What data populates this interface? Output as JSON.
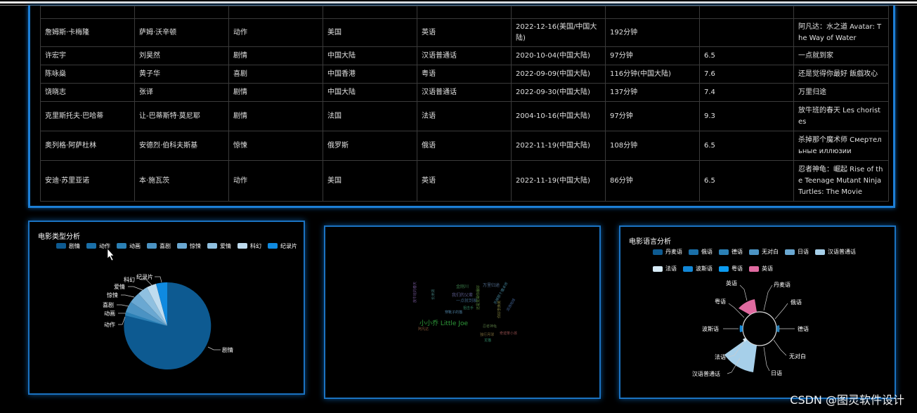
{
  "table": {
    "rows": [
      [
        "",
        "",
        "",
        "",
        "",
        "",
        "",
        "",
        "",
        "|"
      ],
      [
        "詹姆斯·卡梅隆",
        "萨姆·沃辛顿",
        "动作",
        "美国",
        "英语",
        "2022-12-16(美国/中国大陆)",
        "192分钟",
        "",
        "阿凡达：水之道 Avatar: The Way of Water"
      ],
      [
        "许宏宇",
        "刘昊然",
        "剧情",
        "中国大陆",
        "汉语普通话",
        "2020-10-04(中国大陆)",
        "97分钟",
        "6.5",
        "一点就到家"
      ],
      [
        "陈咏燊",
        "黄子华",
        "喜剧",
        "中国香港",
        "粤语",
        "2022-09-09(中国大陆)",
        "116分钟(中国大陆)",
        "7.6",
        "还是觉得你最好 飯戲攻心"
      ],
      [
        "饶晓志",
        "张译",
        "剧情",
        "中国大陆",
        "汉语普通话",
        "2022-09-30(中国大陆)",
        "137分钟",
        "7.4",
        "万里归途"
      ],
      [
        "克里斯托夫·巴哈蒂",
        "让-巴蒂斯特·莫尼耶",
        "剧情",
        "法国",
        "法语",
        "2004-10-16(中国大陆)",
        "97分钟",
        "9.3",
        "放牛班的春天 Les choristes"
      ],
      [
        "奥列格·阿萨杜林",
        "安德烈·伯科夫斯基",
        "惊悚",
        "俄罗斯",
        "俄语",
        "2022-11-19(中国大陆)",
        "108分钟",
        "6.5",
        "杀掉那个魔术师 Смертельные иллюзии"
      ],
      [
        "安迪·苏里亚诺",
        "本·施瓦茨",
        "动作",
        "美国",
        "英语",
        "2022-11-19(中国大陆)",
        "86分钟",
        "6.5",
        "忍者神龟：崛起 Rise of the Teenage Mutant Ninja Turtles: The Movie"
      ]
    ]
  },
  "genre_panel": {
    "title": "电影类型分析",
    "legend": [
      {
        "name": "剧情",
        "color": "#0d5a91"
      },
      {
        "name": "动作",
        "color": "#1a6fa8"
      },
      {
        "name": "动画",
        "color": "#2b80b5"
      },
      {
        "name": "喜剧",
        "color": "#4b93c3"
      },
      {
        "name": "惊悚",
        "color": "#6aa8d2"
      },
      {
        "name": "爱情",
        "color": "#8fc0e0"
      },
      {
        "name": "科幻",
        "color": "#bfdcef"
      },
      {
        "name": "纪录片",
        "color": "#0f8ae0"
      }
    ]
  },
  "language_panel": {
    "title": "电影语言分析",
    "legend": [
      {
        "name": "丹麦语",
        "color": "#0d5a91"
      },
      {
        "name": "俄语",
        "color": "#1a6fa8"
      },
      {
        "name": "德语",
        "color": "#2b80b5"
      },
      {
        "name": "无对白",
        "color": "#4b93c3"
      },
      {
        "name": "日语",
        "color": "#6aa8d2"
      },
      {
        "name": "汉语普通话",
        "color": "#a6cfe9"
      },
      {
        "name": "法语",
        "color": "#d7ebf7"
      },
      {
        "name": "波斯语",
        "color": "#1287d6"
      },
      {
        "name": "粤语",
        "color": "#0b9bf0"
      },
      {
        "name": "英语",
        "color": "#e06aa0"
      }
    ]
  },
  "wordcloud": {
    "words": [
      {
        "text": "小小乔 Little Joe",
        "color": "#2e9a3a"
      },
      {
        "text": "金刚川",
        "color": "#3c7d4b"
      },
      {
        "text": "万里归途",
        "color": "#4f6a8a"
      },
      {
        "text": "一点就到家",
        "color": "#3b5f7f"
      },
      {
        "text": "还是觉得你最好",
        "color": "#5a8a3c"
      },
      {
        "text": "放牛班的春天",
        "color": "#6a4f8a"
      },
      {
        "text": "杀掉那个魔术师",
        "color": "#3f7a8f"
      },
      {
        "text": "阿凡达",
        "color": "#8a5a3a"
      },
      {
        "text": "忍者神龟",
        "color": "#4d6a3a"
      },
      {
        "text": "我们的父辈",
        "color": "#5b5b8c"
      },
      {
        "text": "长津湖",
        "color": "#3a6f6f"
      },
      {
        "text": "独行月球",
        "color": "#7a6a3a"
      },
      {
        "text": "流浪地球",
        "color": "#3d5d8d"
      },
      {
        "text": "狙击手",
        "color": "#2f7f5f"
      },
      {
        "text": "奇迹笨小孩",
        "color": "#8c4a4a"
      },
      {
        "text": "穿靴子的猫",
        "color": "#4a7a9a"
      },
      {
        "text": "龙猫",
        "color": "#2e8060"
      },
      {
        "text": "你好李焕英",
        "color": "#7a7a3a"
      }
    ]
  },
  "watermark": "CSDN @图灵软件设计"
}
